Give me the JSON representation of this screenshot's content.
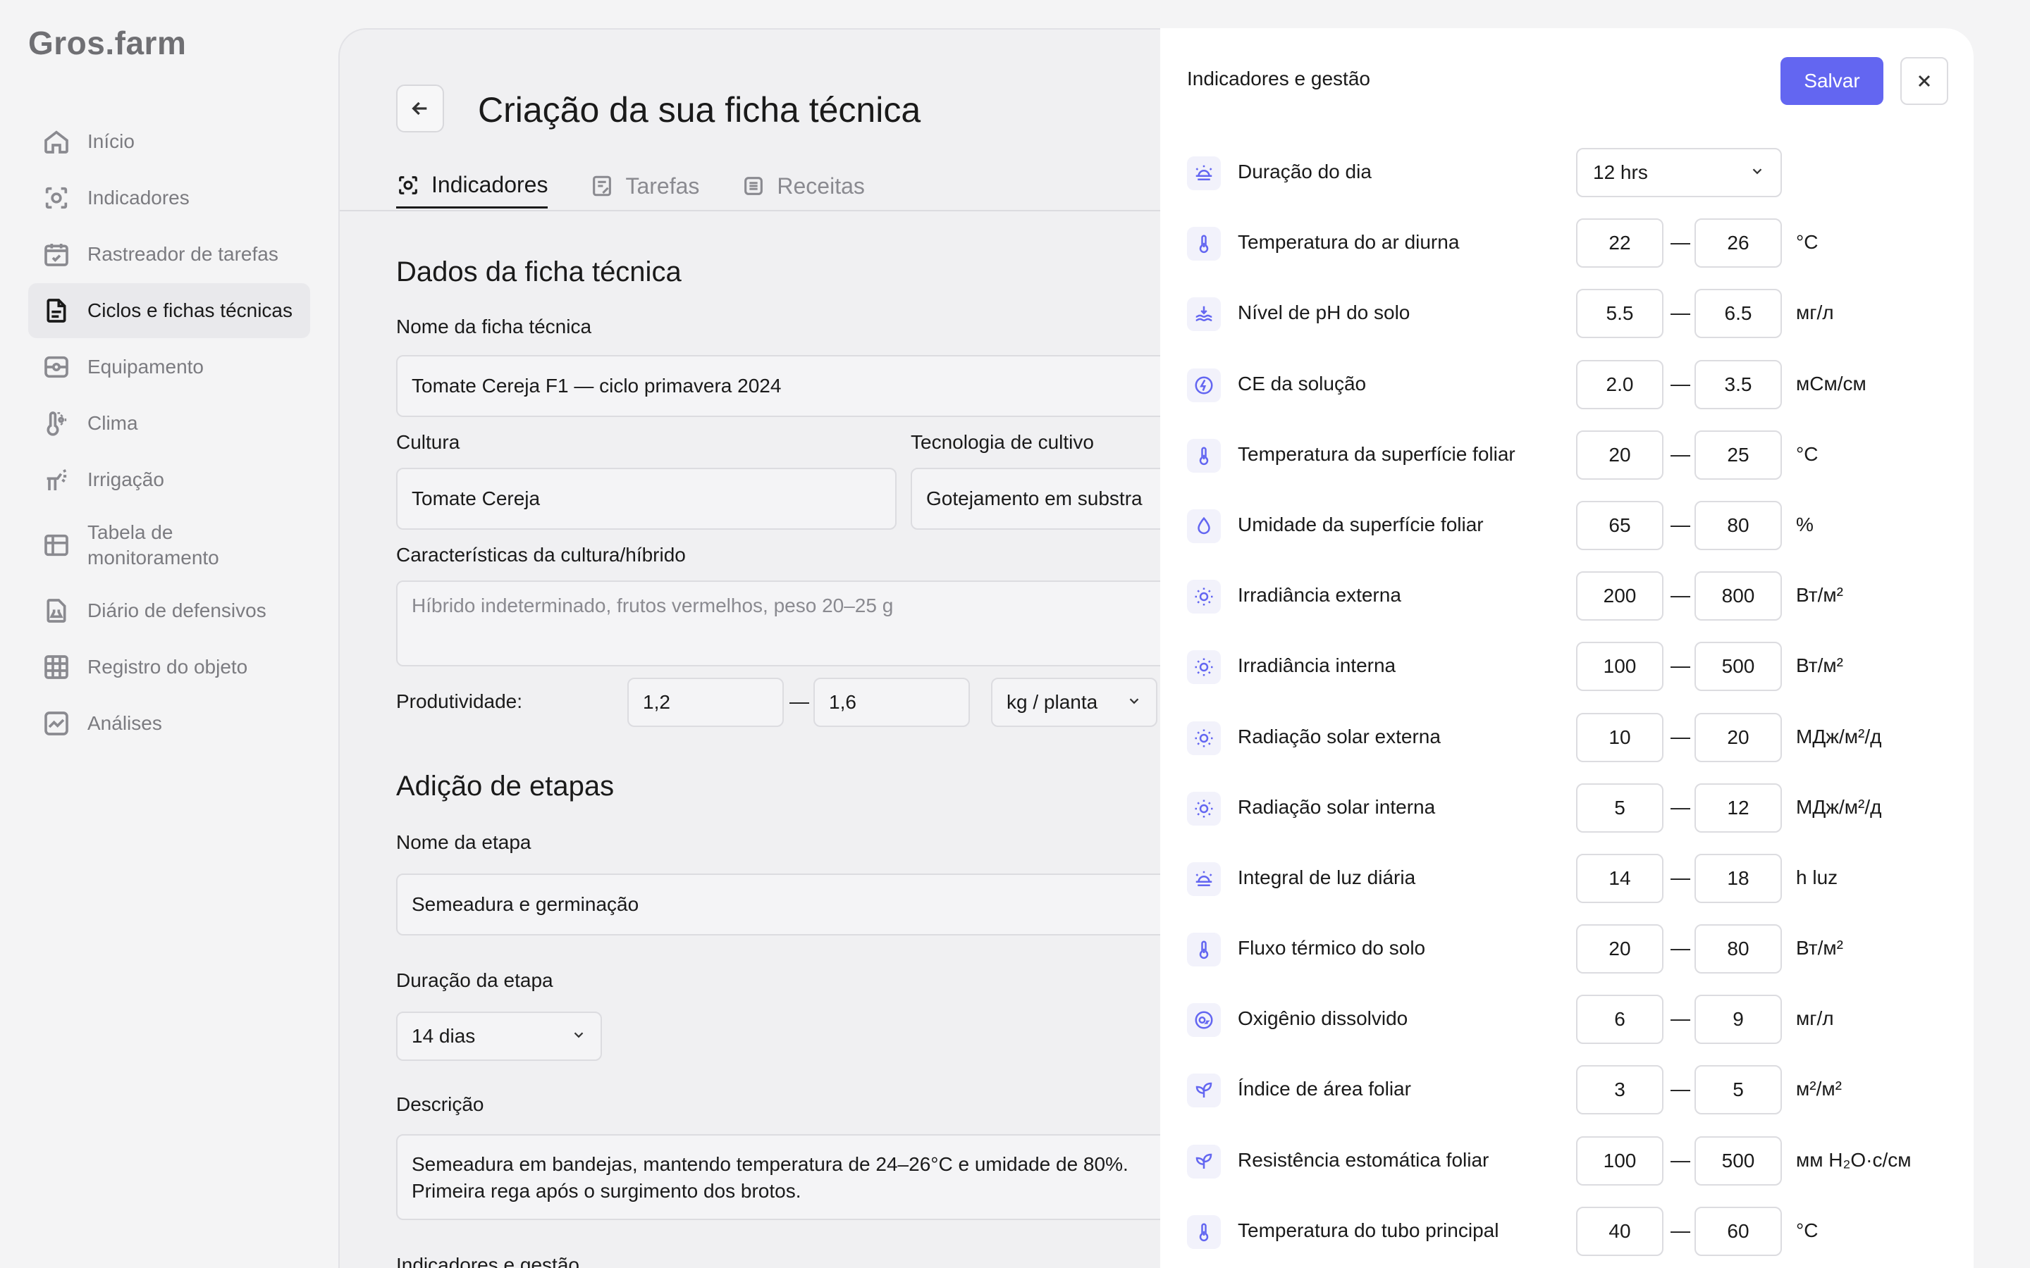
{
  "app": {
    "logo": "Gros.farm"
  },
  "sidebar": {
    "items": [
      {
        "label": "Início",
        "icon": "home-icon"
      },
      {
        "label": "Indicadores",
        "icon": "indicators-icon"
      },
      {
        "label": "Rastreador de tarefas",
        "icon": "calendar-check-icon"
      },
      {
        "label": "Ciclos e fichas técnicas",
        "icon": "document-icon",
        "active": true
      },
      {
        "label": "Equipamento",
        "icon": "equipment-icon"
      },
      {
        "label": "Clima",
        "icon": "thermometer-sun-icon"
      },
      {
        "label": "Irrigação",
        "icon": "sprinkler-icon"
      },
      {
        "label": "Tabela de monitoramento",
        "icon": "table-icon"
      },
      {
        "label": "Diário de defensivos",
        "icon": "flask-doc-icon"
      },
      {
        "label": "Registro do objeto",
        "icon": "grid-icon"
      },
      {
        "label": "Análises",
        "icon": "chart-icon"
      }
    ]
  },
  "main": {
    "title": "Criação da sua ficha técnica",
    "tabs": [
      {
        "label": "Indicadores",
        "icon": "indicators-icon",
        "active": true
      },
      {
        "label": "Tarefas",
        "icon": "tasks-icon"
      },
      {
        "label": "Receitas",
        "icon": "recipes-icon"
      }
    ],
    "sheet": {
      "section_title": "Dados da ficha técnica",
      "name_label": "Nome da ficha técnica",
      "name_value": "Tomate Cereja F1 — ciclo primavera 2024",
      "culture_label": "Cultura",
      "culture_value": "Tomate Cereja",
      "tech_label": "Tecnologia de cultivo",
      "tech_value": "Gotejamento em substra",
      "traits_label": "Características da cultura/híbrido",
      "traits_placeholder": "Híbrido indeterminado, frutos vermelhos, peso 20–25 g",
      "productivity_label": "Produtividade:",
      "productivity_min": "1,2",
      "productivity_max": "1,6",
      "productivity_unit": "kg / planta",
      "dash": "—"
    },
    "stages": {
      "section_title": "Adição de etapas",
      "name_label": "Nome da etapa",
      "name_value": "Semeadura e germinação",
      "duration_label": "Duração da etapa",
      "duration_value": "14 dias",
      "description_label": "Descrição",
      "description_value": "Semeadura em bandejas, mantendo temperatura de 24–26°C e umidade de 80%. Primeira rega após o surgimento dos brotos.",
      "indicators_label": "Indicadores e gestão"
    }
  },
  "panel": {
    "title": "Indicadores e gestão",
    "save_label": "Salvar",
    "dash": "—",
    "day_length": {
      "name": "Duração do dia",
      "value": "12 hrs",
      "icon": "sunrise-icon"
    },
    "indicators": [
      {
        "name": "Temperatura do ar diurna",
        "min": "22",
        "max": "26",
        "unit": "°C",
        "icon": "thermometer-icon"
      },
      {
        "name": "Nível de pH do solo",
        "min": "5.5",
        "max": "6.5",
        "unit": "мг/л",
        "icon": "soil-icon"
      },
      {
        "name": "CE da solução",
        "min": "2.0",
        "max": "3.5",
        "unit": "мСм/см",
        "icon": "ec-icon"
      },
      {
        "name": "Temperatura da superfície foliar",
        "min": "20",
        "max": "25",
        "unit": "°C",
        "icon": "thermometer-icon"
      },
      {
        "name": "Umidade da superfície foliar",
        "min": "65",
        "max": "80",
        "unit": "%",
        "icon": "droplet-icon"
      },
      {
        "name": "Irradiância externa",
        "min": "200",
        "max": "800",
        "unit": "Вт/м²",
        "icon": "sun-icon"
      },
      {
        "name": "Irradiância interna",
        "min": "100",
        "max": "500",
        "unit": "Вт/м²",
        "icon": "sun-icon"
      },
      {
        "name": "Radiação solar externa",
        "min": "10",
        "max": "20",
        "unit": "МДж/м²/д",
        "icon": "sun-icon"
      },
      {
        "name": "Radiação solar interna",
        "min": "5",
        "max": "12",
        "unit": "МДж/м²/д",
        "icon": "sun-icon"
      },
      {
        "name": "Integral de luz diária",
        "min": "14",
        "max": "18",
        "unit": "h luz",
        "icon": "sunrise-icon"
      },
      {
        "name": "Fluxo térmico do solo",
        "min": "20",
        "max": "80",
        "unit": "Вт/м²",
        "icon": "thermometer-icon"
      },
      {
        "name": "Oxigênio dissolvido",
        "min": "6",
        "max": "9",
        "unit": "мг/л",
        "icon": "o2-icon"
      },
      {
        "name": "Índice de área foliar",
        "min": "3",
        "max": "5",
        "unit": "м²/м²",
        "icon": "leaf-icon"
      },
      {
        "name": "Resistência estomática foliar",
        "min": "100",
        "max": "500",
        "unit": "мм H₂O·с/см",
        "icon": "leaf-icon"
      },
      {
        "name": "Temperatura do tubo principal",
        "min": "40",
        "max": "60",
        "unit": "°C",
        "icon": "thermometer-icon"
      }
    ]
  }
}
